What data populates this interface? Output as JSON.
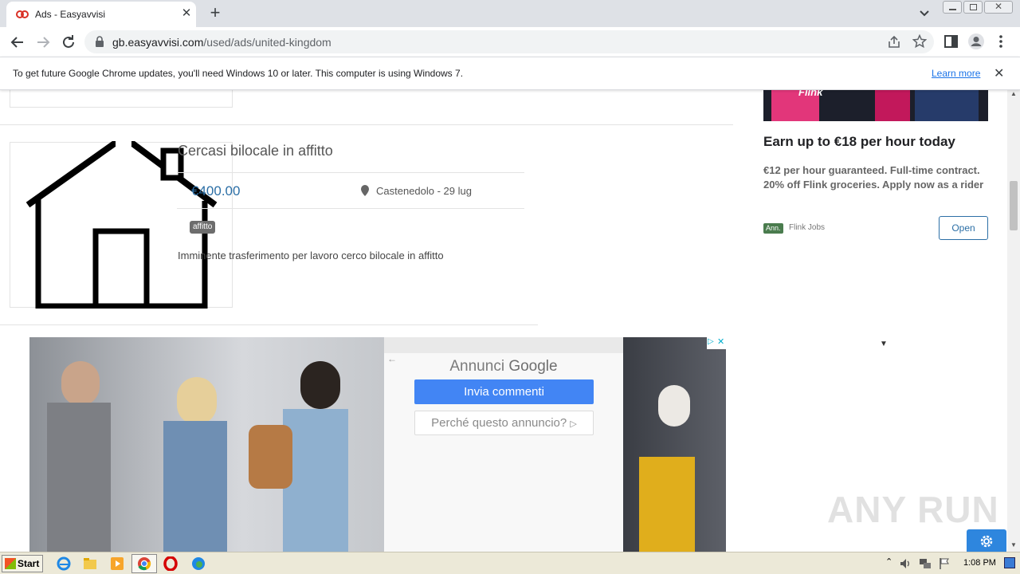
{
  "browser": {
    "tab_title": "Ads - Easyavvisi",
    "url_host": "gb.easyavvisi.com",
    "url_path": "/used/ads/united-kingdom"
  },
  "infobar": {
    "message": "To get future Google Chrome updates, you'll need Windows 10 or later. This computer is using Windows 7.",
    "link": "Learn more"
  },
  "listing": {
    "title": "Cercasi bilocale in affitto",
    "price": "€400.00",
    "location": "Castenedolo - 29 lug",
    "tag": "affitto",
    "description": "Imminente trasferimento per lavoro  cerco bilocale in affitto"
  },
  "side_ad": {
    "image_text": "Flink",
    "headline": "Earn up to €18 per hour today",
    "body": "€12 per hour guaranteed. Full-time contract. 20% off Flink groceries. Apply now as a rider",
    "badge": "Ann.",
    "advertiser": "Flink Jobs",
    "open_label": "Open"
  },
  "google_ad": {
    "heading_prefix": "Annunci",
    "heading_brand": "Google",
    "feedback_label": "Invia commenti",
    "why_label": "Perché questo annuncio?"
  },
  "watermark": "ANY RUN",
  "taskbar": {
    "start_label": "Start",
    "clock": "1:08 PM"
  },
  "colors": {
    "accent_blue": "#4285f4",
    "price_blue": "#2c6fa6",
    "taskbar": "#ece9d8"
  }
}
